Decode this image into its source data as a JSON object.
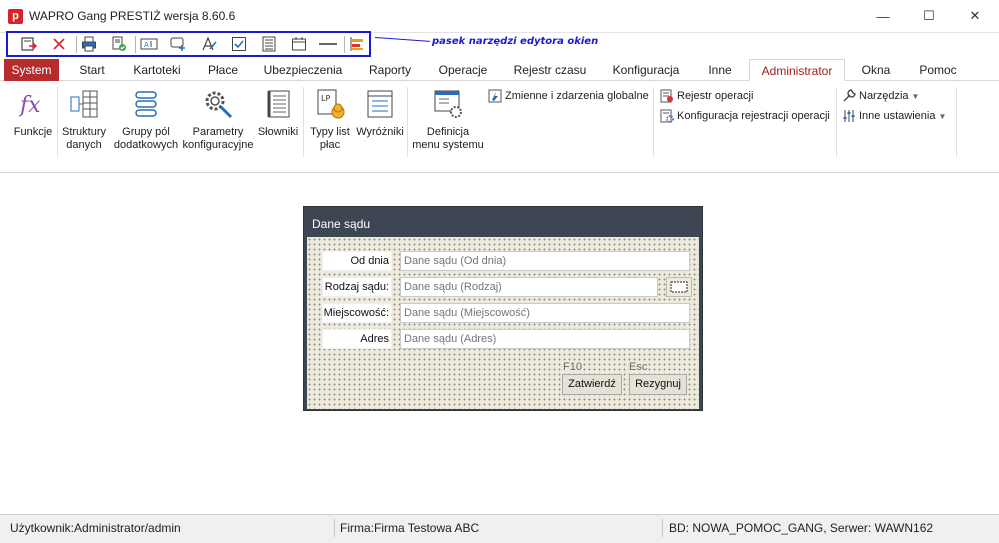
{
  "window": {
    "app_logo_letter": "p",
    "title": "WAPRO Gang PRESTIŻ wersja 8.60.6",
    "minimize_glyph": "—",
    "maximize_glyph": "☐",
    "close_glyph": "✕"
  },
  "quick_access": {
    "annotation": "pasek narzędzi edytora okien",
    "highlight_color": "#1a1ad2"
  },
  "tabs": [
    {
      "label": "System"
    },
    {
      "label": "Start"
    },
    {
      "label": "Kartoteki"
    },
    {
      "label": "Płace"
    },
    {
      "label": "Ubezpieczenia"
    },
    {
      "label": "Raporty"
    },
    {
      "label": "Operacje"
    },
    {
      "label": "Rejestr czasu"
    },
    {
      "label": "Konfiguracja"
    },
    {
      "label": "Inne"
    },
    {
      "label": "Administrator"
    },
    {
      "label": "Okna"
    },
    {
      "label": "Pomoc"
    }
  ],
  "ribbon": {
    "funkcje": {
      "line1": "Funkcje",
      "line2": ""
    },
    "struktury": {
      "line1": "Struktury",
      "line2": "danych"
    },
    "grupy": {
      "line1": "Grupy pól",
      "line2": "dodatkowych"
    },
    "parametry": {
      "line1": "Parametry",
      "line2": "konfiguracyjne"
    },
    "slowniki": {
      "line1": "Słowniki",
      "line2": ""
    },
    "typy": {
      "line1": "Typy list",
      "line2": "płac"
    },
    "wyrozniki": {
      "line1": "Wyróżniki",
      "line2": ""
    },
    "definicja": {
      "line1": "Definicja",
      "line2": "menu systemu"
    },
    "zmienne": "Zmienne i zdarzenia globalne",
    "rejestr_operacji": "Rejestr operacji",
    "konfiguracja_rejestracji": "Konfiguracja rejestracji operacji",
    "narzedzia": "Narzędzia",
    "inne_ustawienia": "Inne ustawienia"
  },
  "dialog": {
    "title": "Dane sądu",
    "fields": [
      {
        "label": "Od dnia",
        "placeholder": "Dane sądu (Od dnia)"
      },
      {
        "label": "Rodzaj sądu:",
        "placeholder": "Dane sądu (Rodzaj)"
      },
      {
        "label": "Miejscowość:",
        "placeholder": "Dane sądu (Miejscowość)"
      },
      {
        "label": "Adres",
        "placeholder": "Dane sądu (Adres)"
      }
    ],
    "confirm_hotkey": "F10",
    "confirm_label": "Zatwierdź",
    "cancel_hotkey": "Esc",
    "cancel_label": "Rezygnuj"
  },
  "status": {
    "user": "Użytkownik:Administrator/admin",
    "company": "Firma:Firma Testowa ABC",
    "db": "BD: NOWA_POMOC_GANG, Serwer: WAWN162"
  },
  "colors": {
    "system_tab": "#b52c2c",
    "active_tab_text": "#a02020",
    "dialog_header": "#3e4653",
    "dialog_body": "#eeeadb"
  }
}
